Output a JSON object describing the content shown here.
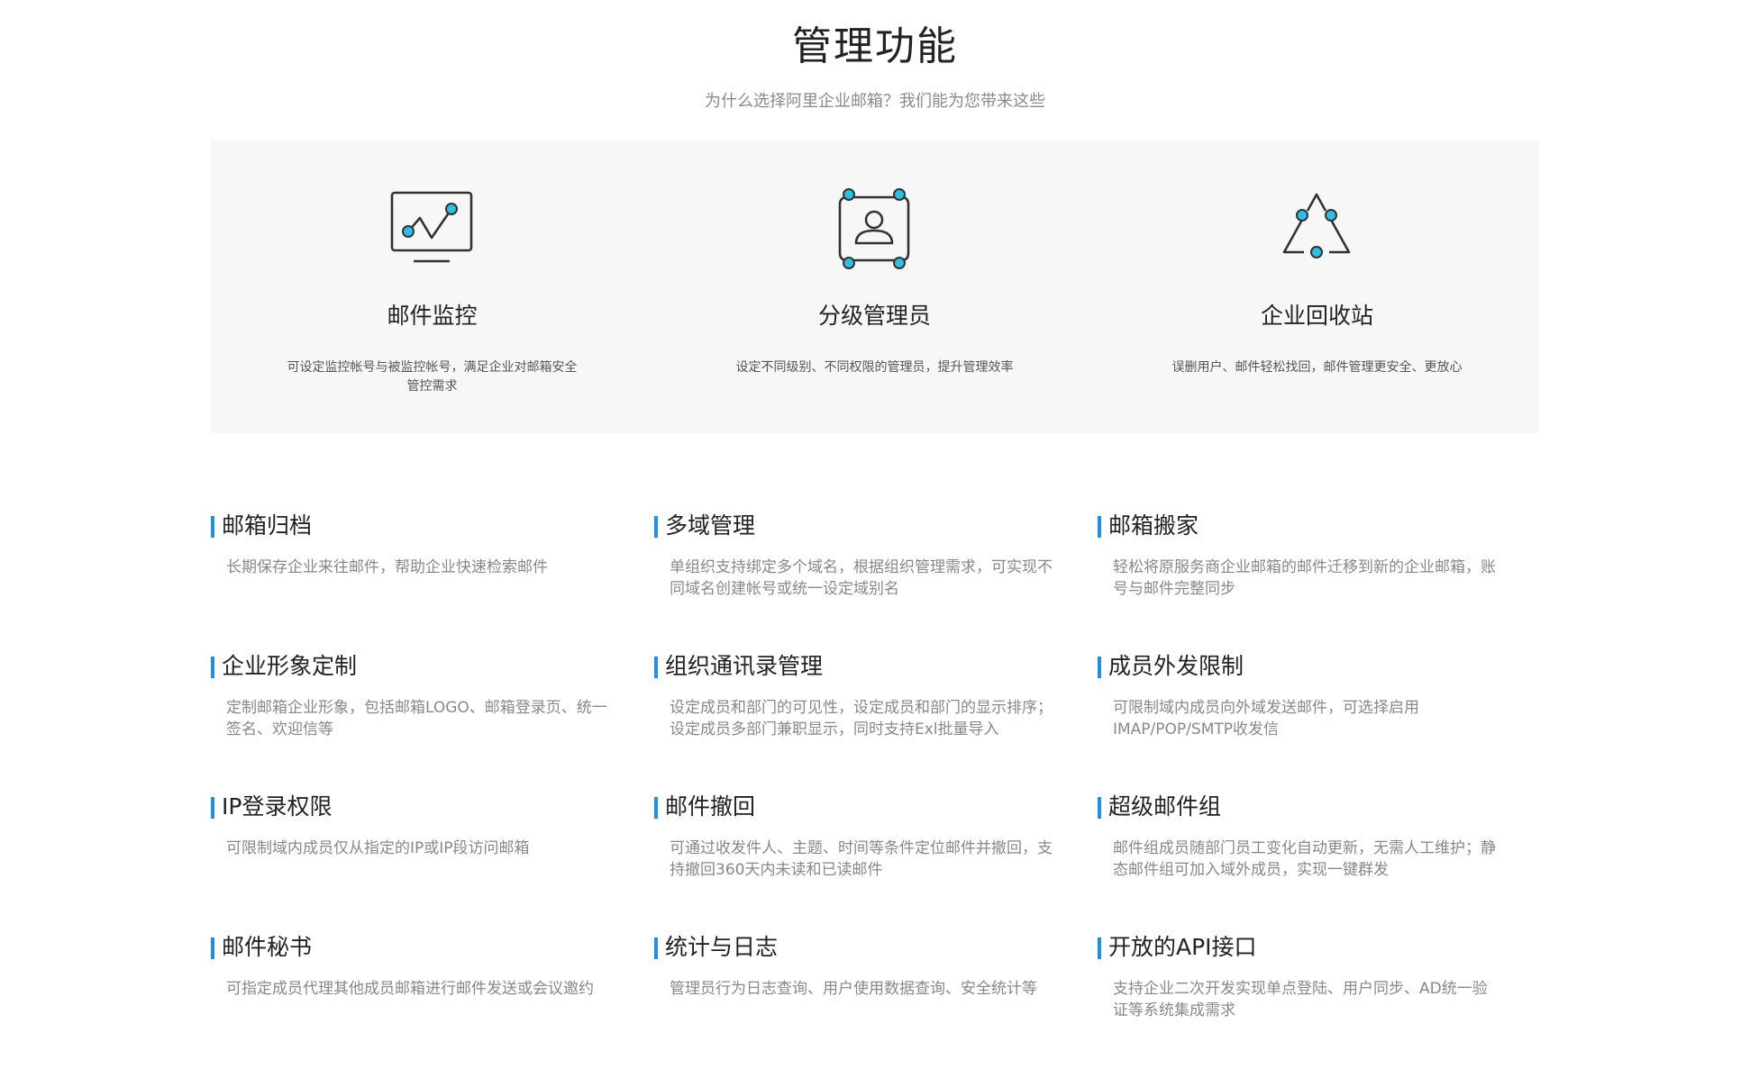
{
  "header": {
    "title": "管理功能",
    "subtitle": "为什么选择阿里企业邮箱？我们能为您带来这些"
  },
  "colors": {
    "accent": "#1e8ee8",
    "icon_dot": "#2bc0e4",
    "panel_bg": "#f7f7f7"
  },
  "top_features": [
    {
      "icon": "monitor-chart-icon",
      "title": "邮件监控",
      "desc": "可设定监控帐号与被监控帐号，满足企业对邮箱安全管控需求"
    },
    {
      "icon": "admin-person-icon",
      "title": "分级管理员",
      "desc": "设定不同级别、不同权限的管理员，提升管理效率"
    },
    {
      "icon": "recycle-triangle-icon",
      "title": "企业回收站",
      "desc": "误删用户、邮件轻松找回，邮件管理更安全、更放心"
    }
  ],
  "features": [
    {
      "title": "邮箱归档",
      "desc": "长期保存企业来往邮件，帮助企业快速检索邮件"
    },
    {
      "title": "多域管理",
      "desc": "单组织支持绑定多个域名，根据组织管理需求，可实现不同域名创建帐号或统一设定域别名"
    },
    {
      "title": "邮箱搬家",
      "desc": "轻松将原服务商企业邮箱的邮件迁移到新的企业邮箱，账号与邮件完整同步"
    },
    {
      "title": "企业形象定制",
      "desc": "定制邮箱企业形象，包括邮箱LOGO、邮箱登录页、统一签名、欢迎信等"
    },
    {
      "title": "组织通讯录管理",
      "desc": "设定成员和部门的可见性，设定成员和部门的显示排序；设定成员多部门兼职显示，同时支持Exl批量导入"
    },
    {
      "title": "成员外发限制",
      "desc": "可限制域内成员向外域发送邮件，可选择启用IMAP/POP/SMTP收发信"
    },
    {
      "title": "IP登录权限",
      "desc": "可限制域内成员仅从指定的IP或IP段访问邮箱"
    },
    {
      "title": "邮件撤回",
      "desc": "可通过收发件人、主题、时间等条件定位邮件并撤回，支持撤回360天内未读和已读邮件"
    },
    {
      "title": "超级邮件组",
      "desc": "邮件组成员随部门员工变化自动更新，无需人工维护；静态邮件组可加入域外成员，实现一键群发"
    },
    {
      "title": "邮件秘书",
      "desc": "可指定成员代理其他成员邮箱进行邮件发送或会议邀约"
    },
    {
      "title": "统计与日志",
      "desc": "管理员行为日志查询、用户使用数据查询、安全统计等"
    },
    {
      "title": "开放的API接口",
      "desc": "支持企业二次开发实现单点登陆、用户同步、AD统一验证等系统集成需求"
    }
  ]
}
